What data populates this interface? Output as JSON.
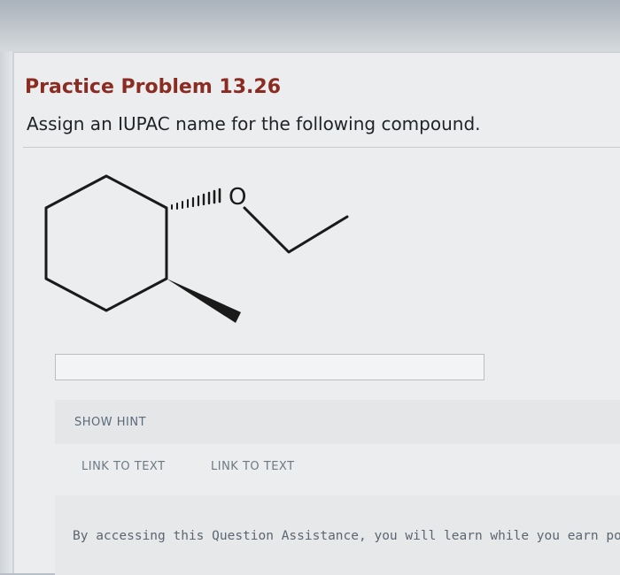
{
  "problem": {
    "title": "Practice Problem 13.26",
    "instruction": "Assign an IUPAC name for the following compound."
  },
  "structure": {
    "oxygen_label": "O"
  },
  "answer": {
    "value": ""
  },
  "hint": {
    "show_hint_label": "SHOW HINT"
  },
  "links": {
    "link_to_text_1": "LINK TO TEXT",
    "link_to_text_2": "LINK TO TEXT"
  },
  "footer": {
    "text": "By accessing this Question Assistance, you will learn while you earn po"
  }
}
